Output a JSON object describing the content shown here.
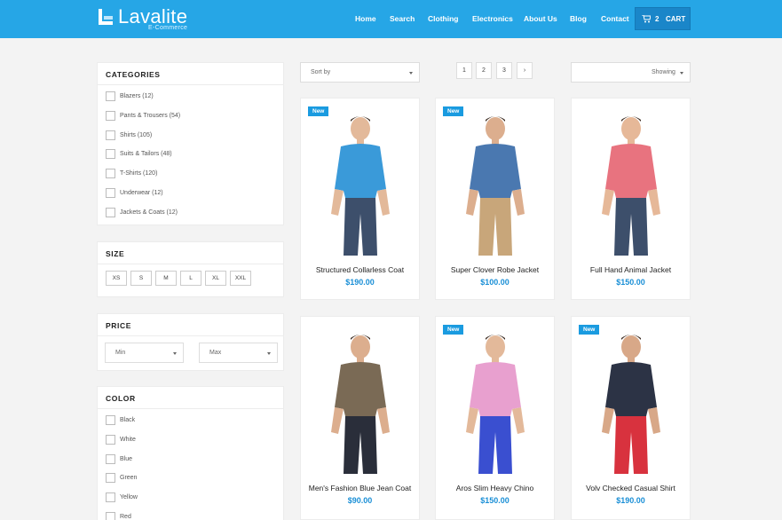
{
  "brand": {
    "name": "Lavalite",
    "tagline": "E-Commerce"
  },
  "nav": [
    "Home",
    "Search",
    "Clothing",
    "Electronics",
    "About Us",
    "Blog",
    "Contact"
  ],
  "cart": {
    "count": "2",
    "label": "CART"
  },
  "categories": {
    "title": "CATEGORIES",
    "items": [
      "Blazers (12)",
      "Pants & Trousers (54)",
      "Shirts (105)",
      "Suits & Tailors (48)",
      "T-Shirts (120)",
      "Underwear (12)",
      "Jackets & Coats (12)"
    ]
  },
  "size": {
    "title": "SIZE",
    "options": [
      "XS",
      "S",
      "M",
      "L",
      "XL",
      "XXL"
    ]
  },
  "price": {
    "title": "PRICE",
    "min": "Min",
    "max": "Max"
  },
  "color": {
    "title": "COLOR",
    "items": [
      "Black",
      "White",
      "Blue",
      "Green",
      "Yellow",
      "Red"
    ]
  },
  "toolbar": {
    "sort": "Sort by",
    "pages": [
      "1",
      "2",
      "3"
    ],
    "showing": "Showing"
  },
  "products": [
    {
      "name": "Structured Collarless Coat",
      "price": "$190.00",
      "badge": "New",
      "shirt": "#3a9ad9",
      "pants": "#3d4f6b",
      "skin": "#e3b99a"
    },
    {
      "name": "Super Clover Robe Jacket",
      "price": "$100.00",
      "badge": "New",
      "shirt": "#4a78b0",
      "pants": "#c8a67a",
      "skin": "#dcae8e"
    },
    {
      "name": "Full Hand Animal Jacket",
      "price": "$150.00",
      "badge": "",
      "shirt": "#e8737f",
      "pants": "#3d4f6b",
      "skin": "#e6b898"
    },
    {
      "name": "Men's Fashion Blue Jean Coat",
      "price": "$90.00",
      "badge": "",
      "shirt": "#7a6a55",
      "pants": "#2a2e3a",
      "skin": "#dcae8e"
    },
    {
      "name": "Aros Slim Heavy Chino",
      "price": "$150.00",
      "badge": "New",
      "shirt": "#e8a0cf",
      "pants": "#3a4fd0",
      "skin": "#e3b99a"
    },
    {
      "name": "Volv Checked Casual Shirt",
      "price": "$190.00",
      "badge": "New",
      "shirt": "#2c3345",
      "pants": "#d8323e",
      "skin": "#d8a888"
    }
  ]
}
